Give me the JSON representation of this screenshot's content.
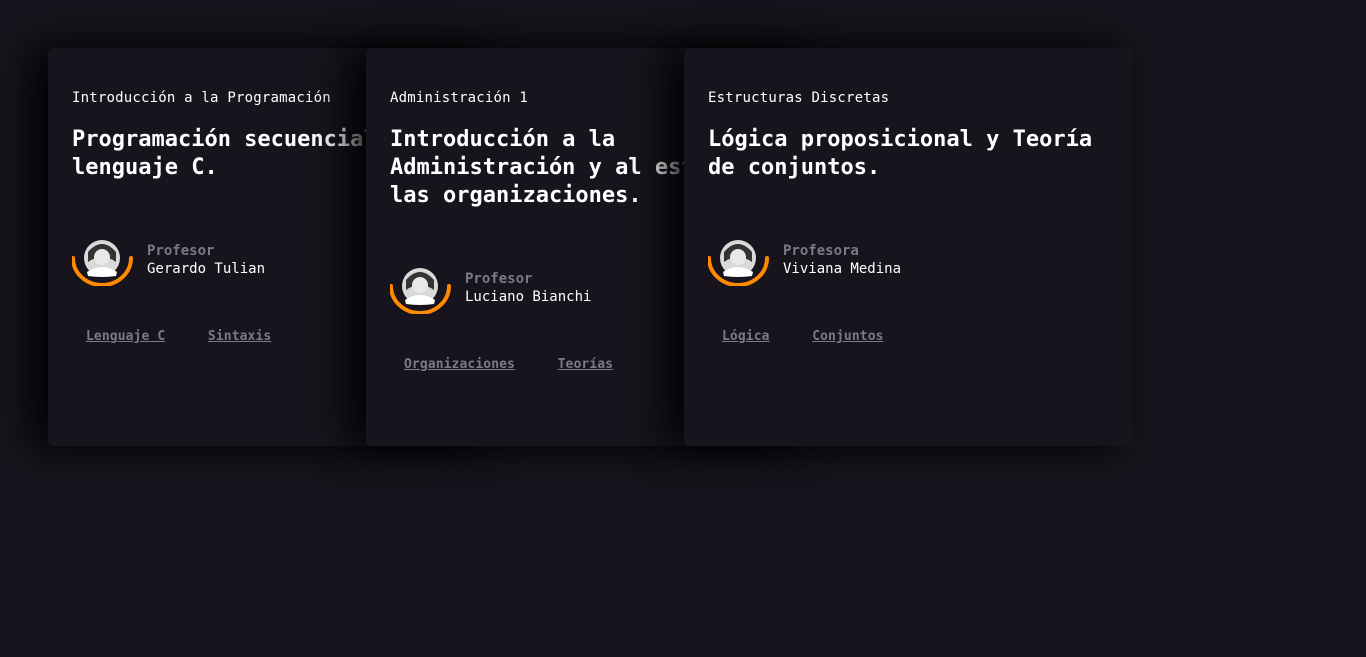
{
  "cards": [
    {
      "subject": "Introducción a la Programación",
      "title": "Programación secuencial con lenguaje C.",
      "role": "Profesor",
      "name": "Gerardo Tulian",
      "tags": [
        "Lenguaje C",
        "Sintaxis"
      ],
      "avatar_icon": "user-avatar-icon"
    },
    {
      "subject": "Administración 1",
      "title": "Introducción a la Administración y al estudio de las organizaciones.",
      "role": "Profesor",
      "name": "Luciano Bianchi",
      "tags": [
        "Organizaciones",
        "Teorías"
      ],
      "avatar_icon": "user-avatar-icon"
    },
    {
      "subject": "Estructuras Discretas",
      "title": "Lógica proposicional y Teoría de conjuntos.",
      "role": "Profesora",
      "name": "Viviana Medina",
      "tags": [
        "Lógica",
        "Conjuntos"
      ],
      "avatar_icon": "user-avatar-icon"
    }
  ],
  "colors": {
    "background": "#17141d",
    "accent_arc": "#ff8a00",
    "muted_text": "#7a7a8c",
    "primary_text": "#ffffff"
  }
}
